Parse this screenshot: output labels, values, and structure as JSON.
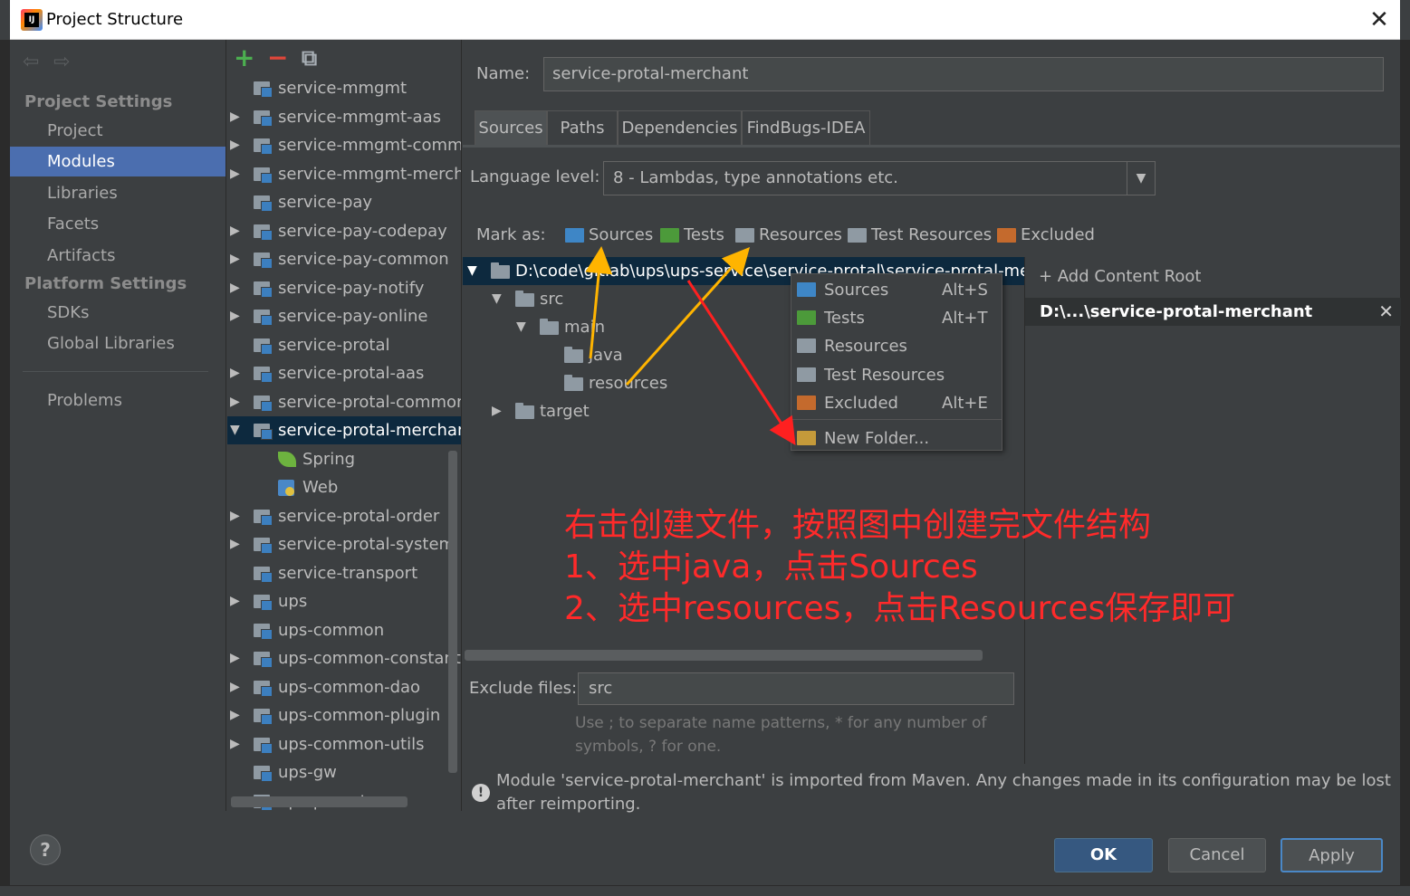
{
  "window": {
    "title": "Project Structure",
    "close_glyph": "✕"
  },
  "nav": {
    "back": "⇦",
    "forward": "⇨",
    "project_settings": "Project Settings",
    "items_project": [
      "Project",
      "Modules",
      "Libraries",
      "Facets",
      "Artifacts"
    ],
    "platform_settings": "Platform Settings",
    "items_platform": [
      "SDKs",
      "Global Libraries"
    ],
    "problems": "Problems",
    "selected": "Modules"
  },
  "modules_toolbar": {
    "add": "+",
    "remove": "−",
    "copy": "⧉"
  },
  "modules": [
    {
      "label": "service-mmgmt",
      "expand": ""
    },
    {
      "label": "service-mmgmt-aas",
      "expand": "▶"
    },
    {
      "label": "service-mmgmt-common",
      "expand": "▶"
    },
    {
      "label": "service-mmgmt-merchant",
      "expand": "▶"
    },
    {
      "label": "service-pay",
      "expand": ""
    },
    {
      "label": "service-pay-codepay",
      "expand": "▶"
    },
    {
      "label": "service-pay-common",
      "expand": "▶"
    },
    {
      "label": "service-pay-notify",
      "expand": "▶"
    },
    {
      "label": "service-pay-online",
      "expand": "▶"
    },
    {
      "label": "service-protal",
      "expand": ""
    },
    {
      "label": "service-protal-aas",
      "expand": "▶"
    },
    {
      "label": "service-protal-common",
      "expand": "▶"
    },
    {
      "label": "service-protal-merchant",
      "expand": "▼",
      "selected": true
    },
    {
      "label": "Spring",
      "facet": "spring"
    },
    {
      "label": "Web",
      "facet": "web"
    },
    {
      "label": "service-protal-order",
      "expand": "▶"
    },
    {
      "label": "service-protal-system",
      "expand": "▶"
    },
    {
      "label": "service-transport",
      "expand": ""
    },
    {
      "label": "ups",
      "expand": "▶"
    },
    {
      "label": "ups-common",
      "expand": ""
    },
    {
      "label": "ups-common-constants",
      "expand": "▶"
    },
    {
      "label": "ups-common-dao",
      "expand": "▶"
    },
    {
      "label": "ups-common-plugin",
      "expand": "▶"
    },
    {
      "label": "ups-common-utils",
      "expand": "▶"
    },
    {
      "label": "ups-gw",
      "expand": ""
    },
    {
      "label": "ups-parent",
      "expand": ""
    }
  ],
  "detail": {
    "name_label": "Name:",
    "name_value": "service-protal-merchant",
    "tabs": [
      "Sources",
      "Paths",
      "Dependencies",
      "FindBugs-IDEA"
    ],
    "active_tab": "Sources",
    "language_label": "Language level:",
    "language_value": "8 - Lambdas, type annotations etc.",
    "dropdown_glyph": "▼",
    "mark_as_label": "Mark as:",
    "mark_buttons": [
      {
        "label": "Sources",
        "color": "#3e86c6"
      },
      {
        "label": "Tests",
        "color": "#4c9a3a"
      },
      {
        "label": "Resources",
        "color": "#8f9aa3"
      },
      {
        "label": "Test Resources",
        "color": "#8f9aa3"
      },
      {
        "label": "Excluded",
        "color": "#c46a2d"
      }
    ],
    "tree": {
      "root": "D:\\code\\gitlab\\ups\\ups-service\\service-protal\\service-protal-merchant",
      "src": "src",
      "main": "main",
      "java": "java",
      "resources": "resources",
      "target": "target",
      "open_glyph": "▼",
      "closed_glyph": "▶"
    },
    "add_content_root": "+ Add Content Root",
    "content_root": "D:\\...\\service-protal-merchant",
    "remove_root_glyph": "✕",
    "exclude_label": "Exclude files:",
    "exclude_value": "src",
    "exclude_help": "Use ; to separate name patterns, * for any number of symbols, ? for one.",
    "warning_glyph": "!",
    "warning": "Module 'service-protal-merchant' is imported from Maven. Any changes made in its configuration may be lost after reimporting."
  },
  "context_menu": [
    {
      "label": "Sources",
      "shortcut": "Alt+S",
      "color": "#3e86c6"
    },
    {
      "label": "Tests",
      "shortcut": "Alt+T",
      "color": "#4c9a3a"
    },
    {
      "label": "Resources",
      "shortcut": "",
      "color": "#8f9aa3"
    },
    {
      "label": "Test Resources",
      "shortcut": "",
      "color": "#8f9aa3"
    },
    {
      "label": "Excluded",
      "shortcut": "Alt+E",
      "color": "#c46a2d"
    },
    {
      "label": "New Folder...",
      "shortcut": "",
      "color": "#c49a3a"
    }
  ],
  "annotation": {
    "lines": [
      "右击创建文件，按照图中创建完文件结构",
      "1、选中java，点击Sources",
      "2、选中resources，点击Resources保存即可"
    ],
    "color": "#ff2a2a",
    "arrow_yellow": "#ffb400",
    "arrow_red": "#ff2020"
  },
  "footer": {
    "help": "?",
    "ok": "OK",
    "cancel": "Cancel",
    "apply": "Apply"
  }
}
